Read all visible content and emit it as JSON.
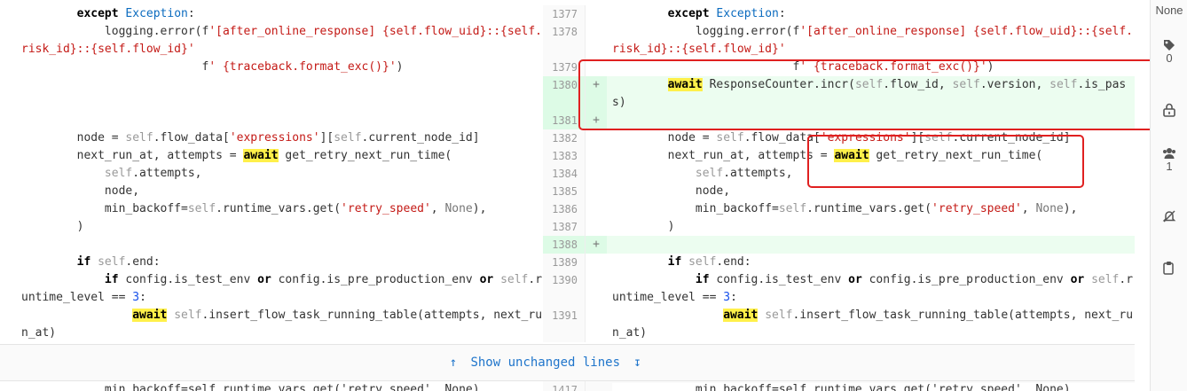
{
  "left": {
    "lines": [
      {
        "segments": [
          {
            "t": "        "
          },
          {
            "t": "except",
            "c": "kw"
          },
          {
            "t": " "
          },
          {
            "t": "Exception",
            "c": "cls"
          },
          {
            "t": ":"
          }
        ]
      },
      {
        "segments": [
          {
            "t": "            logging.error(f"
          },
          {
            "t": "'[after_online_response] {self.flow_uid}::{self.",
            "c": "str"
          }
        ]
      },
      {
        "segments": [
          {
            "t": "risk_id}::{self.flow_id}'",
            "c": "str"
          }
        ]
      },
      {
        "segments": [
          {
            "t": "                          f"
          },
          {
            "t": "' {traceback.format_exc()}'",
            "c": "str"
          },
          {
            "t": ")"
          }
        ]
      },
      {
        "segments": []
      },
      {
        "segments": []
      },
      {
        "segments": []
      },
      {
        "segments": [
          {
            "t": "        node = "
          },
          {
            "t": "self",
            "c": "slf"
          },
          {
            "t": ".flow_data["
          },
          {
            "t": "'expressions'",
            "c": "str"
          },
          {
            "t": "]["
          },
          {
            "t": "self",
            "c": "slf"
          },
          {
            "t": ".current_node_id]"
          }
        ]
      },
      {
        "segments": [
          {
            "t": "        next_run_at, attempts = "
          },
          {
            "t": "await",
            "c": "aw"
          },
          {
            "t": " get_retry_next_run_time("
          }
        ]
      },
      {
        "segments": [
          {
            "t": "            "
          },
          {
            "t": "self",
            "c": "slf"
          },
          {
            "t": ".attempts,"
          }
        ]
      },
      {
        "segments": [
          {
            "t": "            node,"
          }
        ]
      },
      {
        "segments": [
          {
            "t": "            min_backoff="
          },
          {
            "t": "self",
            "c": "slf"
          },
          {
            "t": ".runtime_vars.get("
          },
          {
            "t": "'retry_speed'",
            "c": "str"
          },
          {
            "t": ", "
          },
          {
            "t": "None",
            "c": "none"
          },
          {
            "t": "),"
          }
        ]
      },
      {
        "segments": [
          {
            "t": "        )"
          }
        ]
      },
      {
        "segments": []
      },
      {
        "segments": [
          {
            "t": "        "
          },
          {
            "t": "if",
            "c": "kw"
          },
          {
            "t": " "
          },
          {
            "t": "self",
            "c": "slf"
          },
          {
            "t": ".end:"
          }
        ]
      },
      {
        "segments": [
          {
            "t": "            "
          },
          {
            "t": "if",
            "c": "kw"
          },
          {
            "t": " config.is_test_env "
          },
          {
            "t": "or",
            "c": "kw"
          },
          {
            "t": " config.is_pre_production_env "
          },
          {
            "t": "or",
            "c": "kw"
          },
          {
            "t": " "
          },
          {
            "t": "self",
            "c": "slf"
          },
          {
            "t": ".r"
          }
        ]
      },
      {
        "segments": [
          {
            "t": "untime_level == "
          },
          {
            "t": "3",
            "c": "num"
          },
          {
            "t": ":"
          }
        ]
      },
      {
        "segments": [
          {
            "t": "                "
          },
          {
            "t": "await",
            "c": "aw"
          },
          {
            "t": " "
          },
          {
            "t": "self",
            "c": "slf"
          },
          {
            "t": ".insert_flow_task_running_table(attempts, next_ru"
          }
        ]
      },
      {
        "segments": [
          {
            "t": "n_at)"
          }
        ]
      }
    ]
  },
  "right": {
    "rows": [
      {
        "type": "context",
        "num": "1377",
        "lines": [
          [
            {
              "t": "        "
            },
            {
              "t": "except",
              "c": "kw"
            },
            {
              "t": " "
            },
            {
              "t": "Exception",
              "c": "cls"
            },
            {
              "t": ":"
            }
          ]
        ]
      },
      {
        "type": "context",
        "num": "1378",
        "lines": [
          [
            {
              "t": "            logging.error(f"
            },
            {
              "t": "'[after_online_response] {self.flow_uid}::{self.",
              "c": "str"
            }
          ],
          [
            {
              "t": "risk_id}::{self.flow_id}'",
              "c": "str"
            }
          ]
        ]
      },
      {
        "type": "context",
        "num": "1379",
        "lines": [
          [
            {
              "t": "                          f"
            },
            {
              "t": "' {traceback.format_exc()}'",
              "c": "str"
            },
            {
              "t": ")"
            }
          ]
        ]
      },
      {
        "type": "added",
        "num": "1380",
        "marker": "+",
        "lines": [
          [
            {
              "t": "        "
            },
            {
              "t": "await",
              "c": "aw"
            },
            {
              "t": " ResponseCounter.incr("
            },
            {
              "t": "self",
              "c": "slf"
            },
            {
              "t": ".flow_id, "
            },
            {
              "t": "self",
              "c": "slf"
            },
            {
              "t": ".version, "
            },
            {
              "t": "self",
              "c": "slf"
            },
            {
              "t": ".is_pas"
            }
          ],
          [
            {
              "t": "s)"
            }
          ]
        ]
      },
      {
        "type": "added",
        "num": "1381",
        "marker": "+",
        "lines": [
          []
        ]
      },
      {
        "type": "context",
        "num": "1382",
        "lines": [
          [
            {
              "t": "        node = "
            },
            {
              "t": "self",
              "c": "slf"
            },
            {
              "t": ".flow_data["
            },
            {
              "t": "'expressions'",
              "c": "str"
            },
            {
              "t": "]["
            },
            {
              "t": "self",
              "c": "slf"
            },
            {
              "t": ".current_node_id]"
            }
          ]
        ]
      },
      {
        "type": "context",
        "num": "1383",
        "lines": [
          [
            {
              "t": "        next_run_at, attempts = "
            },
            {
              "t": "await",
              "c": "aw"
            },
            {
              "t": " get_retry_next_run_time("
            }
          ]
        ]
      },
      {
        "type": "context",
        "num": "1384",
        "lines": [
          [
            {
              "t": "            "
            },
            {
              "t": "self",
              "c": "slf"
            },
            {
              "t": ".attempts,"
            }
          ]
        ]
      },
      {
        "type": "context",
        "num": "1385",
        "lines": [
          [
            {
              "t": "            node,"
            }
          ]
        ]
      },
      {
        "type": "context",
        "num": "1386",
        "lines": [
          [
            {
              "t": "            min_backoff="
            },
            {
              "t": "self",
              "c": "slf"
            },
            {
              "t": ".runtime_vars.get("
            },
            {
              "t": "'retry_speed'",
              "c": "str"
            },
            {
              "t": ", "
            },
            {
              "t": "None",
              "c": "none"
            },
            {
              "t": "),"
            }
          ]
        ]
      },
      {
        "type": "context",
        "num": "1387",
        "lines": [
          [
            {
              "t": "        )"
            }
          ]
        ]
      },
      {
        "type": "added",
        "num": "1388",
        "marker": "+",
        "lines": [
          []
        ]
      },
      {
        "type": "context",
        "num": "1389",
        "lines": [
          [
            {
              "t": "        "
            },
            {
              "t": "if",
              "c": "kw"
            },
            {
              "t": " "
            },
            {
              "t": "self",
              "c": "slf"
            },
            {
              "t": ".end:"
            }
          ]
        ]
      },
      {
        "type": "context",
        "num": "1390",
        "lines": [
          [
            {
              "t": "            "
            },
            {
              "t": "if",
              "c": "kw"
            },
            {
              "t": " config.is_test_env "
            },
            {
              "t": "or",
              "c": "kw"
            },
            {
              "t": " config.is_pre_production_env "
            },
            {
              "t": "or",
              "c": "kw"
            },
            {
              "t": " "
            },
            {
              "t": "self",
              "c": "slf"
            },
            {
              "t": ".r"
            }
          ],
          [
            {
              "t": "untime_level == "
            },
            {
              "t": "3",
              "c": "num"
            },
            {
              "t": ":"
            }
          ]
        ]
      },
      {
        "type": "context",
        "num": "1391",
        "lines": [
          [
            {
              "t": "                "
            },
            {
              "t": "await",
              "c": "aw"
            },
            {
              "t": " "
            },
            {
              "t": "self",
              "c": "slf"
            },
            {
              "t": ".insert_flow_task_running_table(attempts, next_ru"
            }
          ],
          [
            {
              "t": "n_at)"
            }
          ]
        ]
      }
    ]
  },
  "expand": {
    "label": "Show unchanged lines",
    "up_icon": "arrow-up-icon",
    "down_icon": "arrow-down-icon"
  },
  "peek": {
    "left_text": "            min_backoff=self.runtime_vars.get('retry_speed', None),",
    "right_num": "1417",
    "right_text": "            min_backoff=self.runtime_vars.get('retry_speed', None),"
  },
  "sidebar": {
    "assignee_value": "None",
    "labels_count": "0",
    "participants_count": "1",
    "icons": [
      "label-icon",
      "lock-icon",
      "users-icon",
      "notifications-off-icon",
      "copy-icon"
    ]
  },
  "colors": {
    "added_bg": "#ecfdf0",
    "annotation": "#e02020",
    "link": "#1f75cb",
    "await_highlight": "#fff04a"
  }
}
